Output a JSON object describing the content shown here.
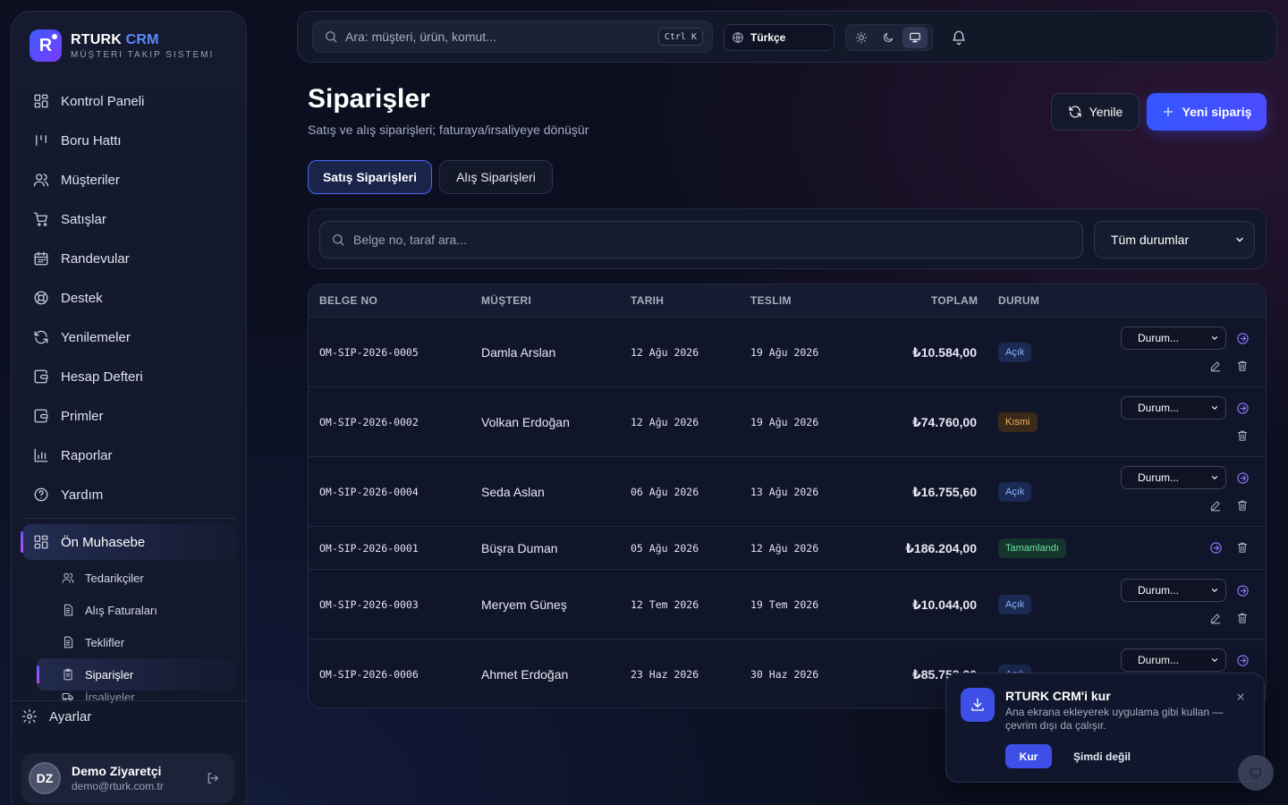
{
  "brand": {
    "name": "RTURK",
    "accent": "CRM",
    "subtitle": "MÜŞTERI TAKIP SISTEMI",
    "logo_letter": "R"
  },
  "sidebar": {
    "items": [
      {
        "label": "Kontrol Paneli",
        "icon": "dashboard-icon"
      },
      {
        "label": "Boru Hattı",
        "icon": "pipeline-icon"
      },
      {
        "label": "Müşteriler",
        "icon": "users-icon"
      },
      {
        "label": "Satışlar",
        "icon": "cart-icon"
      },
      {
        "label": "Randevular",
        "icon": "calendar-icon"
      },
      {
        "label": "Destek",
        "icon": "lifebuoy-icon"
      },
      {
        "label": "Yenilemeler",
        "icon": "refresh-icon"
      },
      {
        "label": "Hesap Defteri",
        "icon": "wallet-icon"
      },
      {
        "label": "Primler",
        "icon": "wallet-icon"
      },
      {
        "label": "Raporlar",
        "icon": "bar-chart-icon"
      },
      {
        "label": "Yardım",
        "icon": "help-icon"
      }
    ],
    "group": {
      "label": "Ön Muhasebe",
      "sub_items": [
        {
          "label": "Tedarikçiler",
          "icon": "users-icon",
          "active": false
        },
        {
          "label": "Alış Faturaları",
          "icon": "document-icon",
          "active": false
        },
        {
          "label": "Teklifler",
          "icon": "document-icon",
          "active": false
        },
        {
          "label": "Siparişler",
          "icon": "clipboard-icon",
          "active": true
        },
        {
          "label": "İrsaliyeler",
          "icon": "truck-icon",
          "active": false
        }
      ]
    },
    "settings_label": "Ayarlar",
    "user": {
      "initials": "DZ",
      "name": "Demo Ziyaretçi",
      "email": "demo@rturk.com.tr"
    }
  },
  "topbar": {
    "search_placeholder": "Ara: müşteri, ürün, komut...",
    "shortcut": "Ctrl K",
    "language": "Türkçe"
  },
  "page": {
    "title": "Siparişler",
    "subtitle": "Satış ve alış siparişleri; faturaya/irsaliyeye dönüşür",
    "refresh_label": "Yenile",
    "new_label": "Yeni sipariş",
    "tabs": [
      "Satış Siparişleri",
      "Alış Siparişleri"
    ],
    "filter_placeholder": "Belge no, taraf ara...",
    "status_filter": "Tüm durumlar"
  },
  "table": {
    "columns": [
      "BELGE NO",
      "MÜŞTERI",
      "TARIH",
      "TESLIM",
      "TOPLAM",
      "DURUM"
    ],
    "status_select_label": "Durum...",
    "rows": [
      {
        "doc": "OM-SIP-2026-0005",
        "customer": "Damla Arslan",
        "date": "12 Ağu 2026",
        "delivery": "19 Ağu 2026",
        "total": "₺10.584,00",
        "status": "Açık",
        "status_type": "open",
        "has_select": true,
        "has_edit": true
      },
      {
        "doc": "OM-SIP-2026-0002",
        "customer": "Volkan Erdoğan",
        "date": "12 Ağu 2026",
        "delivery": "19 Ağu 2026",
        "total": "₺74.760,00",
        "status": "Kısmi",
        "status_type": "partial",
        "has_select": true,
        "has_edit": false
      },
      {
        "doc": "OM-SIP-2026-0004",
        "customer": "Seda Aslan",
        "date": "06 Ağu 2026",
        "delivery": "13 Ağu 2026",
        "total": "₺16.755,60",
        "status": "Açık",
        "status_type": "open",
        "has_select": true,
        "has_edit": true
      },
      {
        "doc": "OM-SIP-2026-0001",
        "customer": "Büşra Duman",
        "date": "05 Ağu 2026",
        "delivery": "12 Ağu 2026",
        "total": "₺186.204,00",
        "status": "Tamamlandı",
        "status_type": "done",
        "has_select": false,
        "has_edit": false
      },
      {
        "doc": "OM-SIP-2026-0003",
        "customer": "Meryem Güneş",
        "date": "12 Tem 2026",
        "delivery": "19 Tem 2026",
        "total": "₺10.044,00",
        "status": "Açık",
        "status_type": "open",
        "has_select": true,
        "has_edit": true
      },
      {
        "doc": "OM-SIP-2026-0006",
        "customer": "Ahmet Erdoğan",
        "date": "23 Haz 2026",
        "delivery": "30 Haz 2026",
        "total": "₺85.753,20",
        "status": "Açık",
        "status_type": "open",
        "has_select": true,
        "has_edit": true
      }
    ]
  },
  "install_toast": {
    "title": "RTURK CRM'i kur",
    "body": "Ana ekrana ekleyerek uygulama gibi kullan — çevrim dışı da çalışır.",
    "install_label": "Kur",
    "later_label": "Şimdi değil"
  },
  "colors": {
    "accent": "#3557ff",
    "background": "#0b0f1f",
    "open": "#8fb1ff",
    "partial": "#f0b45a",
    "done": "#6fe0a7"
  }
}
